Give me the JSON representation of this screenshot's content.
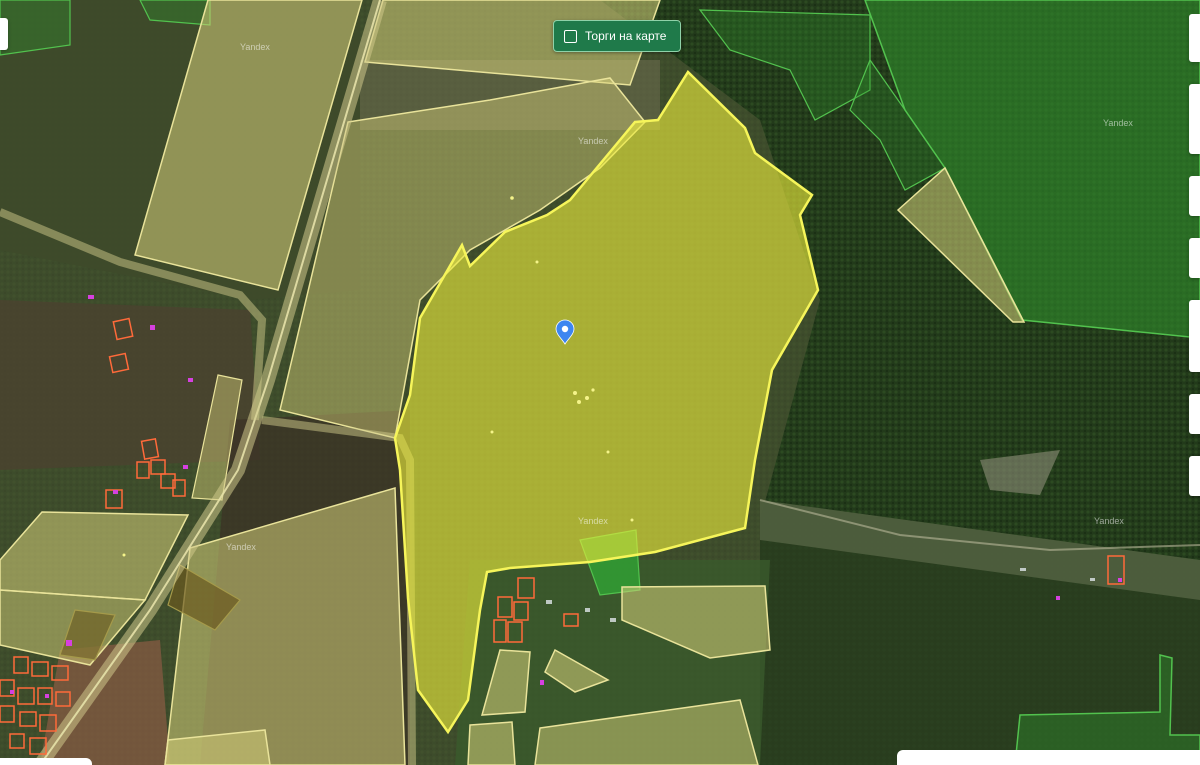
{
  "toolbar": {
    "torgi_label": "Торги на карте"
  },
  "map": {
    "watermark_text": "Yandex",
    "colors": {
      "selected_fill": "#ecec3c",
      "selected_stroke": "#f6f55a",
      "parcel_fill": "#d6d07a",
      "parcel_stroke": "#e9e39a",
      "forest_fill": "#2f8a2c",
      "forest_stroke": "#52c24e",
      "house_stroke": "#ff6a3a",
      "marker": "#3d86f0",
      "building": "#d640e0"
    }
  }
}
